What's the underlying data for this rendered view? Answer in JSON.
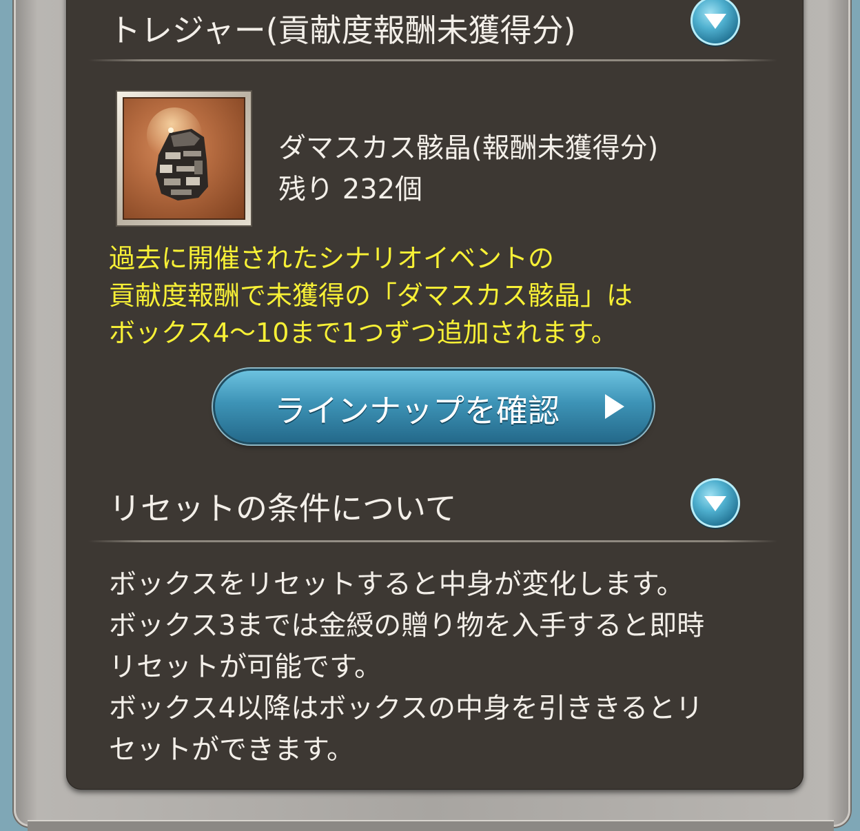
{
  "treasure_section": {
    "title": "トレジャー(貢献度報酬未獲得分)",
    "item": {
      "name": "ダマスカス骸晶(報酬未獲得分)",
      "remaining": "残り 232個",
      "icon": "damascus-crystal-icon"
    },
    "notice_lines": [
      "過去に開催されたシナリオイベントの",
      "貢献度報酬で未獲得の「ダマスカス骸晶」は",
      "ボックス4〜10まで1つずつ追加されます。"
    ],
    "lineup_button": "ラインナップを確認"
  },
  "reset_section": {
    "title": "リセットの条件について",
    "lines": [
      "ボックスをリセットすると中身が変化します。",
      "ボックス3までは金綬の贈り物を入手すると即時",
      "リセットが可能です。",
      "ボックス4以降はボックスの中身を引ききるとリ",
      "セットができます。"
    ]
  },
  "colors": {
    "panel": "#3d3833",
    "notice_text": "#f7f036",
    "button_blue": "#3d93b6"
  }
}
